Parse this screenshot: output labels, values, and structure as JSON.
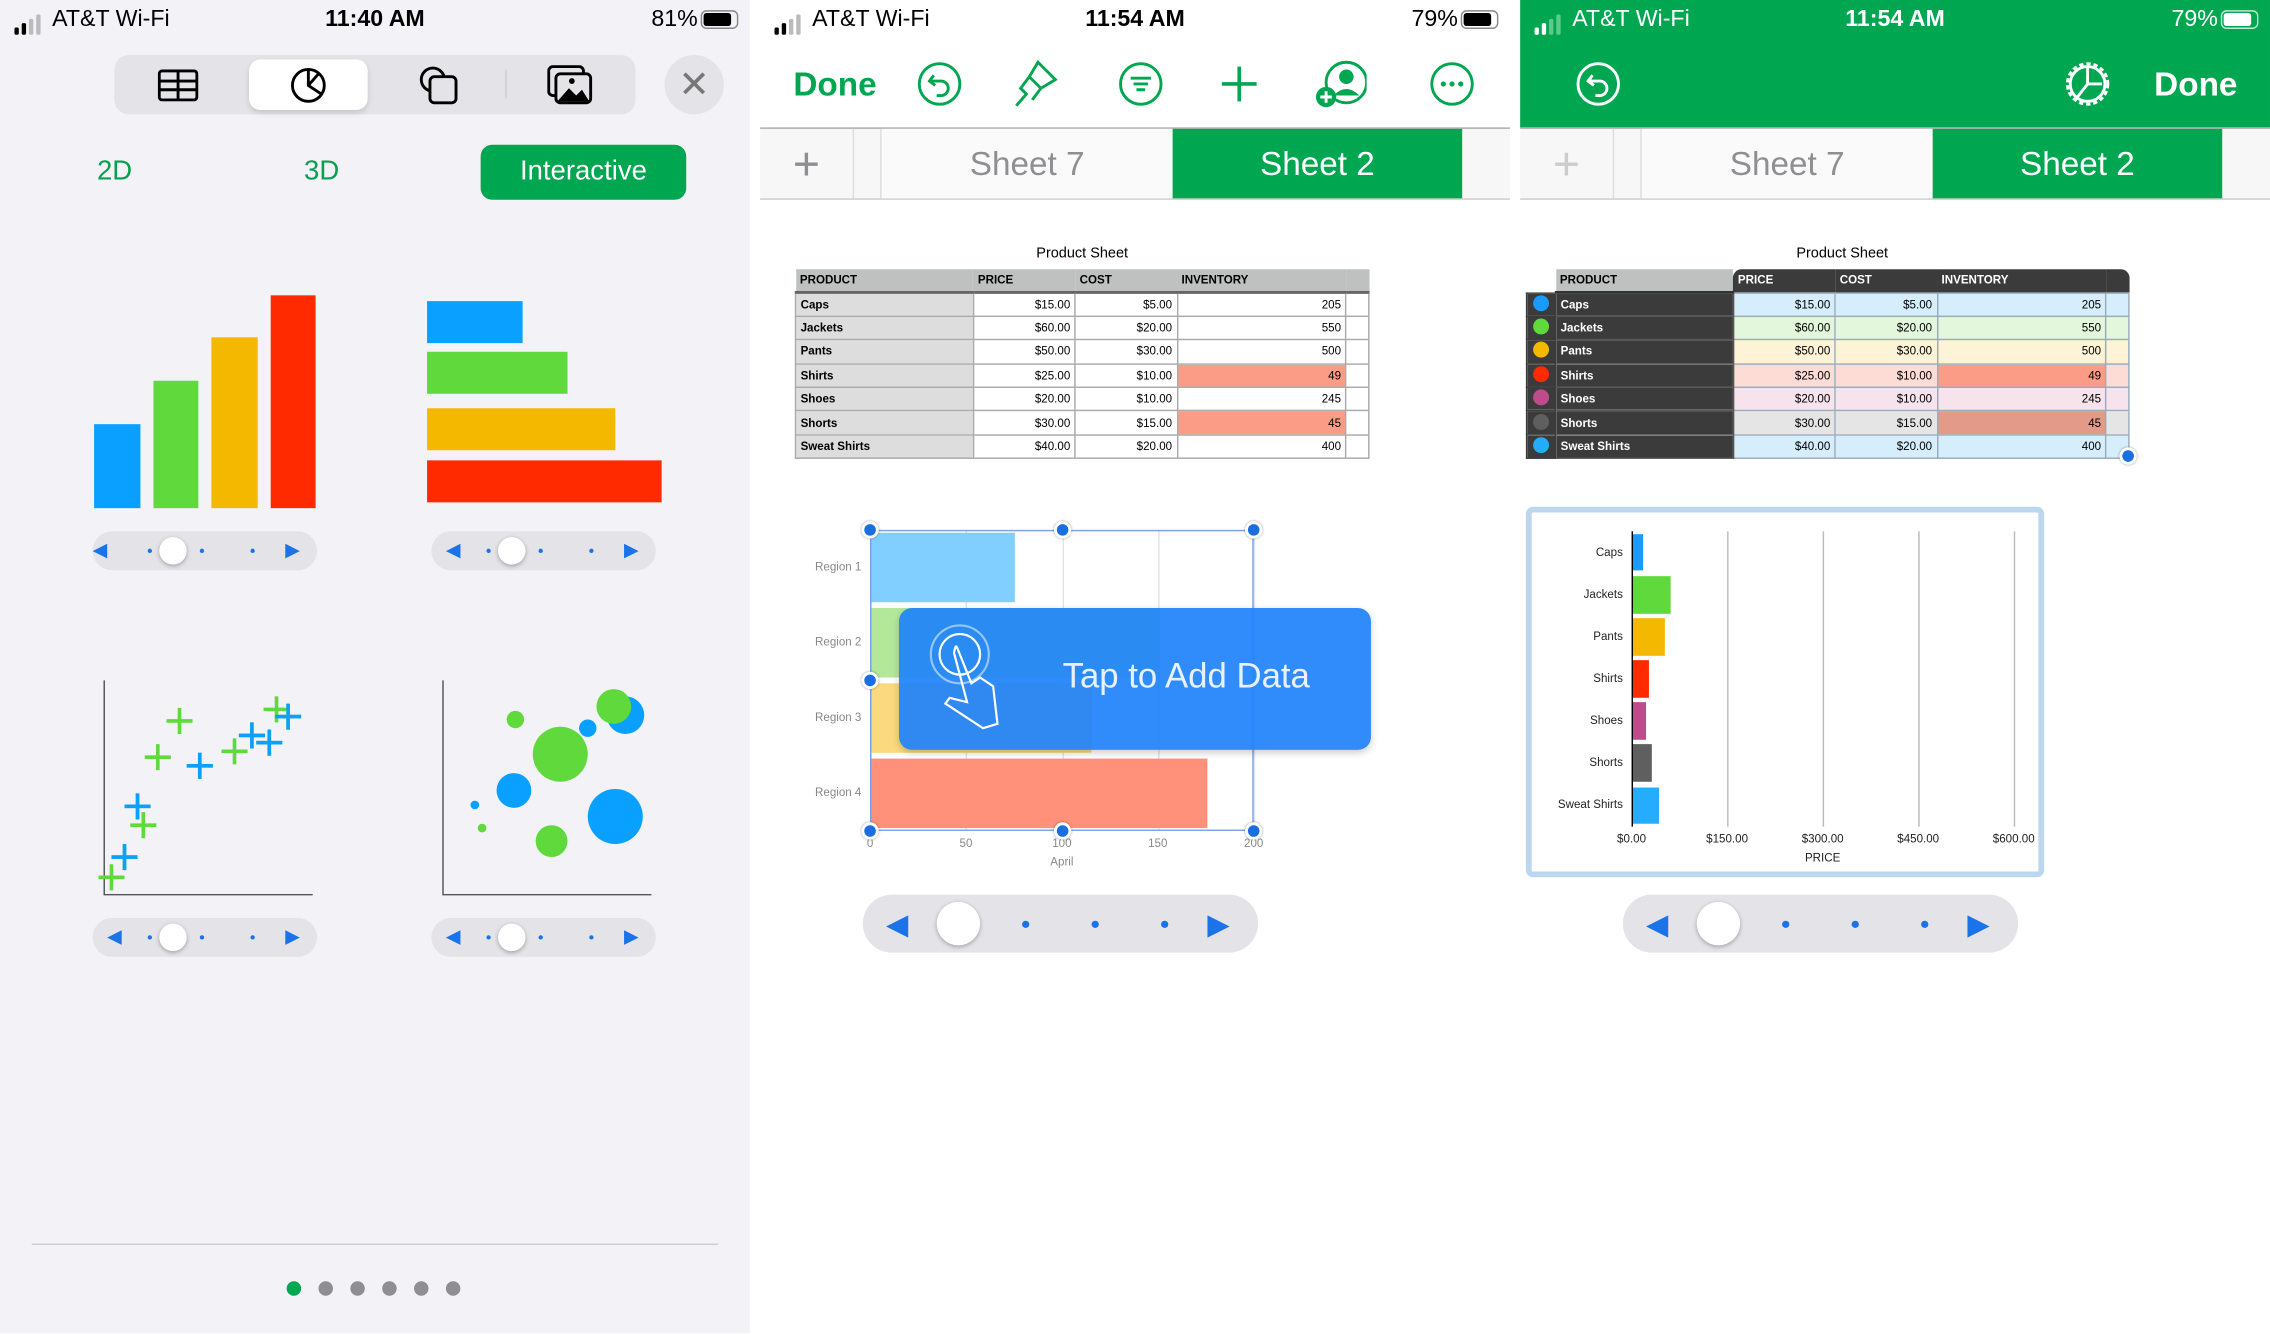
{
  "panel1": {
    "status": {
      "carrier": "AT&T Wi-Fi",
      "time": "11:40 AM",
      "battery": "81%",
      "battery_level": 0.81
    },
    "segments": [
      {
        "icon": "table-icon",
        "selected": false
      },
      {
        "icon": "chart-icon",
        "selected": true
      },
      {
        "icon": "shapes-icon",
        "selected": false
      },
      {
        "icon": "media-icon",
        "selected": false
      }
    ],
    "close_label": "✕",
    "chart_tabs": [
      "2D",
      "3D",
      "Interactive"
    ],
    "active_chart_tab": "Interactive",
    "thumbnails": [
      "interactive-column-chart",
      "interactive-bar-chart",
      "interactive-scatter-chart",
      "interactive-bubble-chart"
    ],
    "page_count": 6,
    "current_page": 1,
    "accent": "#00a650"
  },
  "panel2": {
    "status": {
      "carrier": "AT&T Wi-Fi",
      "time": "11:54 AM",
      "battery": "79%",
      "battery_level": 0.79
    },
    "toolbar": {
      "done": "Done",
      "icons": [
        "undo-icon",
        "paintbrush-icon",
        "format-icon",
        "add-icon",
        "collaborate-icon",
        "more-icon"
      ]
    },
    "tabs": {
      "add": "+",
      "items": [
        "Sheet 7",
        "Sheet 2"
      ],
      "active": "Sheet 2"
    },
    "overlay_text": "Tap to Add Data"
  },
  "panel3": {
    "status": {
      "carrier": "AT&T Wi-Fi",
      "time": "11:54 AM",
      "battery": "79%",
      "battery_level": 0.79
    },
    "toolbar": {
      "done": "Done",
      "icons": [
        "undo-icon",
        "chart-settings-icon"
      ]
    },
    "tabs": {
      "add": "+",
      "items": [
        "Sheet 7",
        "Sheet 2"
      ],
      "active": "Sheet 2"
    }
  },
  "table": {
    "title": "Product Sheet",
    "columns": [
      "PRODUCT",
      "PRICE",
      "COST",
      "INVENTORY",
      ""
    ],
    "rows": [
      [
        "Caps",
        "$15.00",
        "$5.00",
        "205",
        ""
      ],
      [
        "Jackets",
        "$60.00",
        "$20.00",
        "550",
        ""
      ],
      [
        "Pants",
        "$50.00",
        "$30.00",
        "500",
        ""
      ],
      [
        "Shirts",
        "$25.00",
        "$10.00",
        "49",
        ""
      ],
      [
        "Shoes",
        "$20.00",
        "$10.00",
        "245",
        ""
      ],
      [
        "Shorts",
        "$30.00",
        "$15.00",
        "45",
        ""
      ],
      [
        "Sweat Shirts",
        "$40.00",
        "$20.00",
        "400",
        ""
      ]
    ],
    "highlighted_inventory": [
      "49",
      "45"
    ],
    "row_colors": [
      "#1a9bff",
      "#5fd93b",
      "#f5b800",
      "#ff2a00",
      "#c04b8b",
      "#5f5f5f",
      "#24adff"
    ]
  },
  "chart_data": [
    {
      "type": "bar",
      "orientation": "horizontal",
      "categories": [
        "Region 1",
        "Region 2",
        "Region 3",
        "Region 4"
      ],
      "values": [
        75,
        150,
        115,
        175
      ],
      "colors": [
        "#81cfff",
        "#b3e89b",
        "#fbd97e",
        "#ff9079"
      ],
      "xlabel": "April",
      "xlim": [
        0,
        200
      ],
      "xticks": [
        "0",
        "50",
        "100",
        "150",
        "200"
      ],
      "grid": true
    },
    {
      "type": "bar",
      "orientation": "horizontal",
      "categories": [
        "Caps",
        "Jackets",
        "Pants",
        "Shirts",
        "Shoes",
        "Shorts",
        "Sweat Shirts"
      ],
      "values": [
        15,
        60,
        50,
        25,
        20,
        30,
        40
      ],
      "colors": [
        "#1a9bff",
        "#5fd93b",
        "#f5b800",
        "#ff2a00",
        "#c04b8b",
        "#5f5f5f",
        "#24adff"
      ],
      "xlabel": "PRICE",
      "xlim": [
        0,
        600
      ],
      "xticks": [
        "$0.00",
        "$150.00",
        "$300.00",
        "$450.00",
        "$600.00"
      ],
      "grid": true
    }
  ]
}
